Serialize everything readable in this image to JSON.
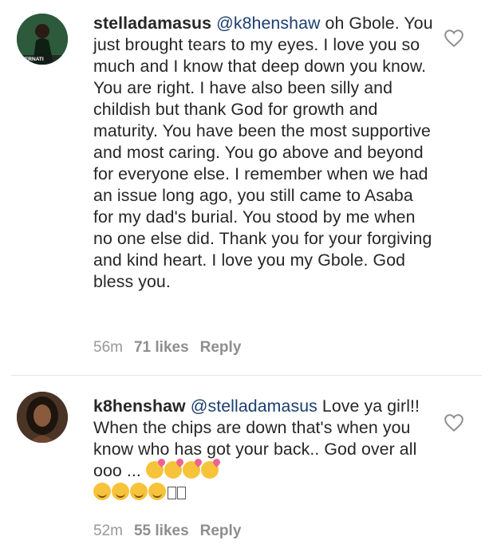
{
  "comments": [
    {
      "username": "stelladamasus",
      "mention": "@k8henshaw",
      "text": " oh Gbole. You just brought tears to my eyes. I love you so much and I know that deep down you know. You are right. I have also been silly and childish but thank God for growth and maturity. You have been the most supportive and most caring. You go above and beyond for everyone else. I remember when we had an issue long ago, you still came to Asaba for my dad's burial. You stood by me when no one else did. Thank you for your forgiving and kind heart. I love you my Gbole. God bless you.",
      "avatar_label": "TERNATI",
      "time": "56m",
      "likes": "71 likes",
      "reply": "Reply"
    },
    {
      "username": "k8henshaw",
      "mention": "@stelladamasus",
      "text": " Love ya girl!! When the chips are down that's when you know who has got your back.. God over all ooo ... ",
      "time": "52m",
      "likes": "55 likes",
      "reply": "Reply"
    }
  ],
  "icons": {
    "like": "heart-outline-icon"
  },
  "colors": {
    "mention": "#1b3e6f",
    "meta": "#999999",
    "text": "#262626"
  }
}
